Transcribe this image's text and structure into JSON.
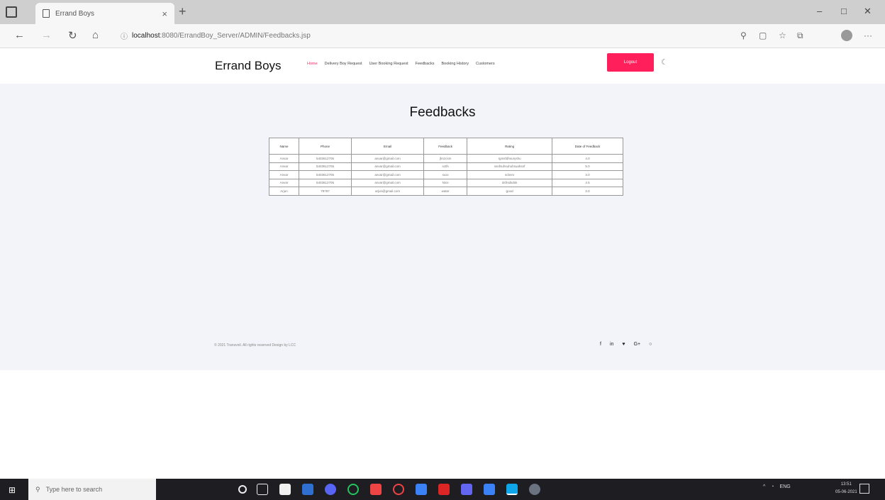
{
  "browser": {
    "tab_title": "Errand Boys",
    "url_host": "localhost",
    "url_rest": ":8080/ErrandBoy_Server/ADMIN/Feedbacks.jsp"
  },
  "site": {
    "brand": "Errand Boys",
    "nav": [
      "Home",
      "Delivery Boy Request",
      "User Booking Request",
      "Feedbacks",
      "Booking History",
      "Customers"
    ],
    "logout_label": "Logout"
  },
  "main": {
    "title": "Feedbacks",
    "table": {
      "headers": [
        "Name",
        "Phone",
        "Email",
        "Feedback",
        "Rating",
        "Date of Feedback"
      ],
      "rows": [
        [
          "Anvar",
          "5403612705",
          "anvar@gmail.com",
          "jhnzcsm",
          "rgmsfdhsuryshu",
          "4.0"
        ],
        [
          "Anvar",
          "5403612705",
          "anvar@gmail.com",
          "sctfs",
          "ssnfsuhsuhuhsuahsnf",
          "5.0"
        ],
        [
          "Anvar",
          "5403612705",
          "anvar@gmail.com",
          "sxxx",
          "scbnrv",
          "3.0"
        ],
        [
          "Anvar",
          "5403612705",
          "anvar@gmail.com",
          "Nice",
          "dsfrsdsdsk",
          "4.5"
        ],
        [
          "Arjun",
          "79787",
          "arjun@gmail.com",
          "water",
          "good",
          "3.0"
        ]
      ]
    },
    "footer_copy": "© 2021 Transvoil. All rights reserved Design by LCC"
  },
  "taskbar": {
    "search_placeholder": "Type here to search",
    "lang": "ENG",
    "time": "13:51",
    "date": "05-06-2021"
  }
}
